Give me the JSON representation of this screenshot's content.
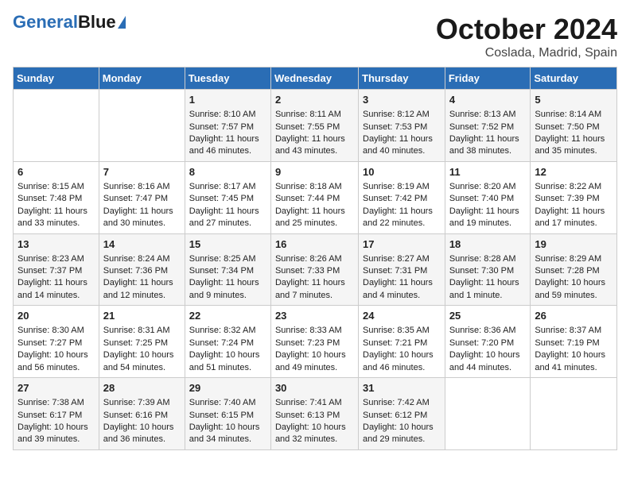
{
  "header": {
    "logo_line1": "General",
    "logo_line2": "Blue",
    "title": "October 2024",
    "subtitle": "Coslada, Madrid, Spain"
  },
  "days_of_week": [
    "Sunday",
    "Monday",
    "Tuesday",
    "Wednesday",
    "Thursday",
    "Friday",
    "Saturday"
  ],
  "weeks": [
    [
      {
        "day": "",
        "sunrise": "",
        "sunset": "",
        "daylight": ""
      },
      {
        "day": "",
        "sunrise": "",
        "sunset": "",
        "daylight": ""
      },
      {
        "day": "1",
        "sunrise": "Sunrise: 8:10 AM",
        "sunset": "Sunset: 7:57 PM",
        "daylight": "Daylight: 11 hours and 46 minutes."
      },
      {
        "day": "2",
        "sunrise": "Sunrise: 8:11 AM",
        "sunset": "Sunset: 7:55 PM",
        "daylight": "Daylight: 11 hours and 43 minutes."
      },
      {
        "day": "3",
        "sunrise": "Sunrise: 8:12 AM",
        "sunset": "Sunset: 7:53 PM",
        "daylight": "Daylight: 11 hours and 40 minutes."
      },
      {
        "day": "4",
        "sunrise": "Sunrise: 8:13 AM",
        "sunset": "Sunset: 7:52 PM",
        "daylight": "Daylight: 11 hours and 38 minutes."
      },
      {
        "day": "5",
        "sunrise": "Sunrise: 8:14 AM",
        "sunset": "Sunset: 7:50 PM",
        "daylight": "Daylight: 11 hours and 35 minutes."
      }
    ],
    [
      {
        "day": "6",
        "sunrise": "Sunrise: 8:15 AM",
        "sunset": "Sunset: 7:48 PM",
        "daylight": "Daylight: 11 hours and 33 minutes."
      },
      {
        "day": "7",
        "sunrise": "Sunrise: 8:16 AM",
        "sunset": "Sunset: 7:47 PM",
        "daylight": "Daylight: 11 hours and 30 minutes."
      },
      {
        "day": "8",
        "sunrise": "Sunrise: 8:17 AM",
        "sunset": "Sunset: 7:45 PM",
        "daylight": "Daylight: 11 hours and 27 minutes."
      },
      {
        "day": "9",
        "sunrise": "Sunrise: 8:18 AM",
        "sunset": "Sunset: 7:44 PM",
        "daylight": "Daylight: 11 hours and 25 minutes."
      },
      {
        "day": "10",
        "sunrise": "Sunrise: 8:19 AM",
        "sunset": "Sunset: 7:42 PM",
        "daylight": "Daylight: 11 hours and 22 minutes."
      },
      {
        "day": "11",
        "sunrise": "Sunrise: 8:20 AM",
        "sunset": "Sunset: 7:40 PM",
        "daylight": "Daylight: 11 hours and 19 minutes."
      },
      {
        "day": "12",
        "sunrise": "Sunrise: 8:22 AM",
        "sunset": "Sunset: 7:39 PM",
        "daylight": "Daylight: 11 hours and 17 minutes."
      }
    ],
    [
      {
        "day": "13",
        "sunrise": "Sunrise: 8:23 AM",
        "sunset": "Sunset: 7:37 PM",
        "daylight": "Daylight: 11 hours and 14 minutes."
      },
      {
        "day": "14",
        "sunrise": "Sunrise: 8:24 AM",
        "sunset": "Sunset: 7:36 PM",
        "daylight": "Daylight: 11 hours and 12 minutes."
      },
      {
        "day": "15",
        "sunrise": "Sunrise: 8:25 AM",
        "sunset": "Sunset: 7:34 PM",
        "daylight": "Daylight: 11 hours and 9 minutes."
      },
      {
        "day": "16",
        "sunrise": "Sunrise: 8:26 AM",
        "sunset": "Sunset: 7:33 PM",
        "daylight": "Daylight: 11 hours and 7 minutes."
      },
      {
        "day": "17",
        "sunrise": "Sunrise: 8:27 AM",
        "sunset": "Sunset: 7:31 PM",
        "daylight": "Daylight: 11 hours and 4 minutes."
      },
      {
        "day": "18",
        "sunrise": "Sunrise: 8:28 AM",
        "sunset": "Sunset: 7:30 PM",
        "daylight": "Daylight: 11 hours and 1 minute."
      },
      {
        "day": "19",
        "sunrise": "Sunrise: 8:29 AM",
        "sunset": "Sunset: 7:28 PM",
        "daylight": "Daylight: 10 hours and 59 minutes."
      }
    ],
    [
      {
        "day": "20",
        "sunrise": "Sunrise: 8:30 AM",
        "sunset": "Sunset: 7:27 PM",
        "daylight": "Daylight: 10 hours and 56 minutes."
      },
      {
        "day": "21",
        "sunrise": "Sunrise: 8:31 AM",
        "sunset": "Sunset: 7:25 PM",
        "daylight": "Daylight: 10 hours and 54 minutes."
      },
      {
        "day": "22",
        "sunrise": "Sunrise: 8:32 AM",
        "sunset": "Sunset: 7:24 PM",
        "daylight": "Daylight: 10 hours and 51 minutes."
      },
      {
        "day": "23",
        "sunrise": "Sunrise: 8:33 AM",
        "sunset": "Sunset: 7:23 PM",
        "daylight": "Daylight: 10 hours and 49 minutes."
      },
      {
        "day": "24",
        "sunrise": "Sunrise: 8:35 AM",
        "sunset": "Sunset: 7:21 PM",
        "daylight": "Daylight: 10 hours and 46 minutes."
      },
      {
        "day": "25",
        "sunrise": "Sunrise: 8:36 AM",
        "sunset": "Sunset: 7:20 PM",
        "daylight": "Daylight: 10 hours and 44 minutes."
      },
      {
        "day": "26",
        "sunrise": "Sunrise: 8:37 AM",
        "sunset": "Sunset: 7:19 PM",
        "daylight": "Daylight: 10 hours and 41 minutes."
      }
    ],
    [
      {
        "day": "27",
        "sunrise": "Sunrise: 7:38 AM",
        "sunset": "Sunset: 6:17 PM",
        "daylight": "Daylight: 10 hours and 39 minutes."
      },
      {
        "day": "28",
        "sunrise": "Sunrise: 7:39 AM",
        "sunset": "Sunset: 6:16 PM",
        "daylight": "Daylight: 10 hours and 36 minutes."
      },
      {
        "day": "29",
        "sunrise": "Sunrise: 7:40 AM",
        "sunset": "Sunset: 6:15 PM",
        "daylight": "Daylight: 10 hours and 34 minutes."
      },
      {
        "day": "30",
        "sunrise": "Sunrise: 7:41 AM",
        "sunset": "Sunset: 6:13 PM",
        "daylight": "Daylight: 10 hours and 32 minutes."
      },
      {
        "day": "31",
        "sunrise": "Sunrise: 7:42 AM",
        "sunset": "Sunset: 6:12 PM",
        "daylight": "Daylight: 10 hours and 29 minutes."
      },
      {
        "day": "",
        "sunrise": "",
        "sunset": "",
        "daylight": ""
      },
      {
        "day": "",
        "sunrise": "",
        "sunset": "",
        "daylight": ""
      }
    ]
  ]
}
